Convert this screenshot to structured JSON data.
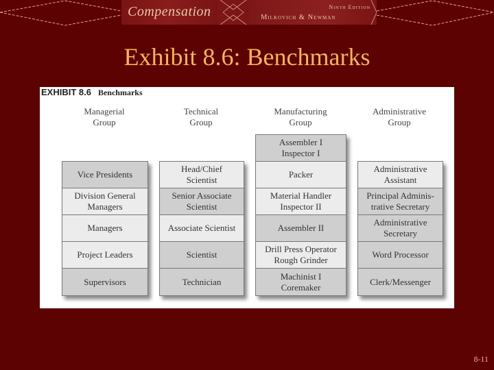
{
  "banner": {
    "book_title": "Compensation",
    "edition": "Ninth Edition",
    "authors": "Milkovich & Newman"
  },
  "slide": {
    "title": "Exhibit 8.6: Benchmarks",
    "page_number": "8-11"
  },
  "exhibit": {
    "label": "EXHIBIT 8.6",
    "name": "Benchmarks",
    "groups": [
      {
        "heading": "Managerial\nGroup",
        "jobs": [
          {
            "title": "Vice Presidents",
            "shade": "dark"
          },
          {
            "title": "Division General\nManagers",
            "shade": "light"
          },
          {
            "title": "Managers",
            "shade": "light"
          },
          {
            "title": "Project Leaders",
            "shade": "light"
          },
          {
            "title": "Supervisors",
            "shade": "dark"
          }
        ]
      },
      {
        "heading": "Technical\nGroup",
        "jobs": [
          {
            "title": "Head/Chief\nScientist",
            "shade": "light"
          },
          {
            "title": "Senior Associate\nScientist",
            "shade": "dark"
          },
          {
            "title": "Associate Scientist",
            "shade": "light"
          },
          {
            "title": "Scientist",
            "shade": "dark"
          },
          {
            "title": "Technician",
            "shade": "dark"
          }
        ]
      },
      {
        "heading": "Manufacturing\nGroup",
        "jobs": [
          {
            "title": "Assembler I\nInspector I",
            "shade": "dark"
          },
          {
            "title": "Packer",
            "shade": "light"
          },
          {
            "title": "Material Handler\nInspector II",
            "shade": "light"
          },
          {
            "title": "Assembler II",
            "shade": "dark"
          },
          {
            "title": "Drill Press Operator\nRough Grinder",
            "shade": "light"
          },
          {
            "title": "Machinist I\nCoremaker",
            "shade": "dark"
          }
        ]
      },
      {
        "heading": "Administrative\nGroup",
        "jobs": [
          {
            "title": "Administrative\nAssistant",
            "shade": "light"
          },
          {
            "title": "Principal Adminis-\ntrative Secretary",
            "shade": "dark"
          },
          {
            "title": "Administrative\nSecretary",
            "shade": "dark"
          },
          {
            "title": "Word Processor",
            "shade": "dark"
          },
          {
            "title": "Clerk/Messenger",
            "shade": "dark"
          }
        ]
      }
    ]
  }
}
